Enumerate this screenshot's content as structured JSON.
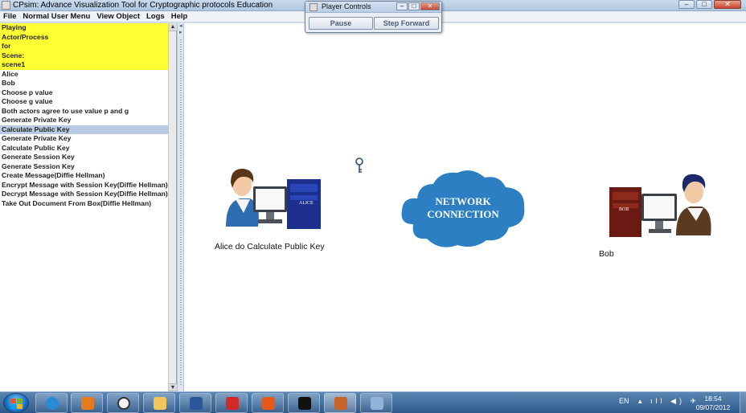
{
  "window": {
    "title": "CPsim: Advance Visualization Tool for Cryptographic protocols Education",
    "buttons": {
      "minimize": "–",
      "maximize": "□",
      "close": "✕"
    }
  },
  "menu": [
    "File",
    "Normal User Menu",
    "View Object",
    "Logs",
    "Help"
  ],
  "list": {
    "header": [
      "Playing",
      "Actor/Process",
      "for",
      "Scene:",
      "scene1"
    ],
    "items": [
      "Alice",
      "Bob",
      "Choose p value",
      "Choose g value",
      "Both actors agree to use value p and g",
      "Generate Private Key",
      "Calculate Public Key",
      "Generate Private Key",
      "Calculate Public Key",
      "Generate Session Key",
      "Generate Session Key",
      "Create Message(Diffie Hellman)",
      "Encrypt Message with Session Key(Diffie Hellman)",
      "Decrypt Message with Session Key(Diffie Hellman)",
      "Take Out Document From Box(Diffie Hellman)"
    ],
    "selected_index": 6
  },
  "scene": {
    "alice_caption": "Alice do Calculate Public Key",
    "alice_monitor_label": "ALICE",
    "bob_caption": "Bob",
    "bob_monitor_label": "BOB",
    "cloud_line1": "NETWORK",
    "cloud_line2": "CONNECTION",
    "cloud_color": "#2b7fc2"
  },
  "player": {
    "title": "Player Controls",
    "pause_label": "Pause",
    "step_label": "Step Forward"
  },
  "taskbar": {
    "apps": [
      "internet-explorer-icon",
      "media-player-icon",
      "clock-gadget-icon",
      "file-explorer-icon",
      "word-icon",
      "kaspersky-icon",
      "app-orange-icon",
      "command-prompt-icon",
      "java-icon",
      "paint-icon"
    ],
    "language": "EN",
    "time": "18:54",
    "date": "09/07/2012"
  }
}
